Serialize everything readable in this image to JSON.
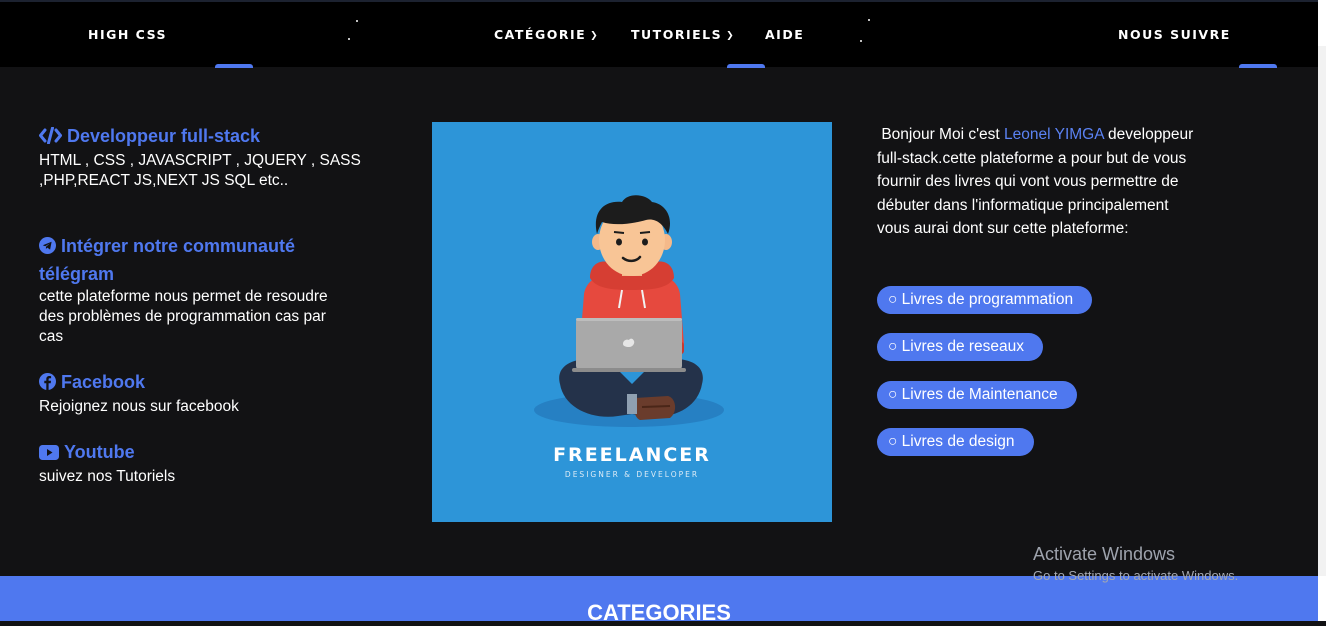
{
  "nav": {
    "brand": "HIGH CSS",
    "categorie": "CATÉGORIE",
    "tutoriels": "TUTORIELS",
    "aide": "AIDE",
    "follow": "NOUS SUIVRE"
  },
  "left": {
    "dev_title": "Developpeur full-stack",
    "dev_text": "HTML , CSS , JAVASCRIPT , JQUERY , SASS ,PHP,REACT JS,NEXT JS SQL etc..",
    "telegram_title": "Intégrer notre communauté télégram",
    "telegram_text": "cette plateforme nous permet de resoudre des problèmes de programmation cas par cas",
    "facebook_title": "Facebook",
    "facebook_text": "Rejoignez nous sur facebook",
    "youtube_title": "Youtube",
    "youtube_text": "suivez nos Tutoriels"
  },
  "hero": {
    "title": "FREELANCER",
    "subtitle": "DESIGNER & DEVELOPER"
  },
  "bio": {
    "intro": "Bonjour Moi c'est",
    "name": "Leonel YIMGA",
    "body": "developpeur full-stack.cette plateforme a pour but de vous fournir des livres qui vont vous permettre de débuter dans l'informatique principalement vous aurai dont sur cette plateforme:"
  },
  "books": [
    "○ Livres de programmation",
    "○ Livres de reseaux",
    "○ Livres de Maintenance",
    "○ Livres de design"
  ],
  "categories_title": "CATEGORIES",
  "watermark": {
    "line1": "Activate Windows",
    "line2": "Go to Settings to activate Windows."
  },
  "colors": {
    "accent": "#4f78ef",
    "background": "#121214",
    "nav_background": "#000000",
    "hero_background": "#2d95d8"
  }
}
